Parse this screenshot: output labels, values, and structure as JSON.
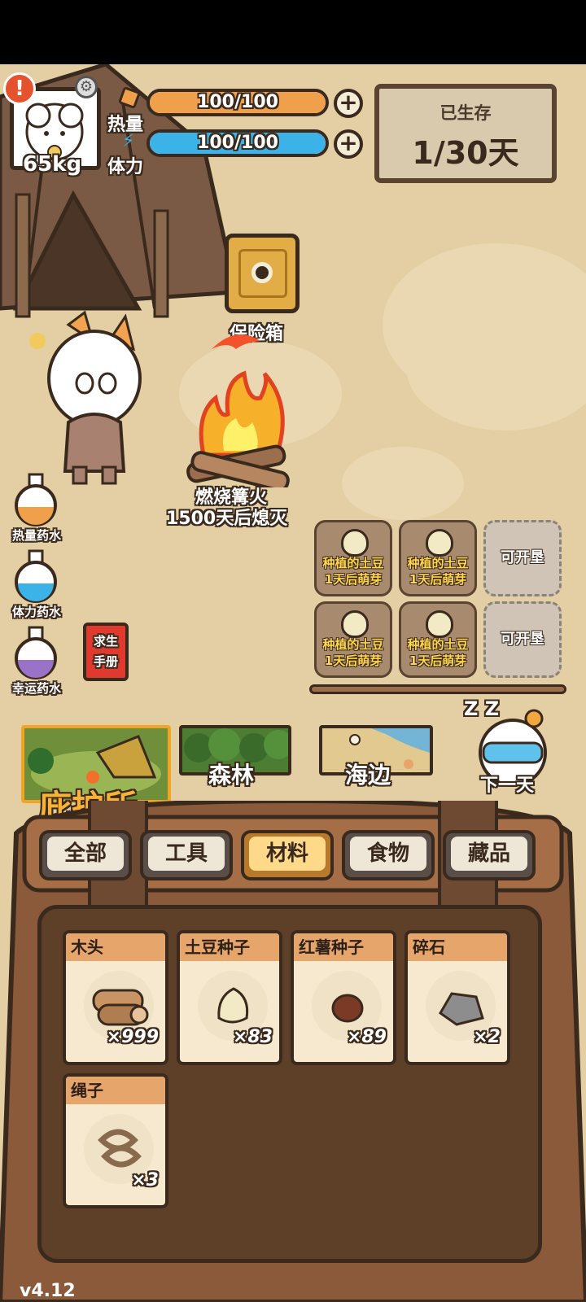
{
  "player": {
    "weight": "65kg"
  },
  "stats": {
    "calories": {
      "label": "热量",
      "value": "100/100",
      "fraction": 1.0,
      "color": "#f0a04b"
    },
    "stamina": {
      "label": "体力",
      "value": "100/100",
      "fraction": 1.0,
      "color": "#3bb2e8"
    }
  },
  "survival": {
    "title": "已生存",
    "days": "1/30天"
  },
  "safe": {
    "label": "保险箱"
  },
  "campfire": {
    "title": "燃烧篝火",
    "status": "1500天后熄灭"
  },
  "plots": [
    {
      "line1": "种植的土豆",
      "line2": "1天后萌芽",
      "empty": false
    },
    {
      "line1": "种植的土豆",
      "line2": "1天后萌芽",
      "empty": false
    },
    {
      "line1": "可开垦",
      "line2": "",
      "empty": true
    },
    {
      "line1": "种植的土豆",
      "line2": "1天后萌芽",
      "empty": false
    },
    {
      "line1": "种植的土豆",
      "line2": "1天后萌芽",
      "empty": false
    },
    {
      "line1": "可开垦",
      "line2": "",
      "empty": true
    }
  ],
  "potions": [
    {
      "label": "热量药水",
      "icon": "orange-potion-icon",
      "color": "#f0a04b"
    },
    {
      "label": "体力药水",
      "icon": "blue-potion-icon",
      "color": "#3bb2e8"
    },
    {
      "label": "幸运药水",
      "icon": "purple-potion-icon",
      "color": "#9a72c8"
    }
  ],
  "manual": {
    "line1": "求生",
    "line2": "手册"
  },
  "locations": {
    "shelter": "庇护所",
    "forest": "森林",
    "beach": "海边"
  },
  "next_day": {
    "label": "下一天",
    "sleep_mark": "Z Z"
  },
  "tabs": [
    "全部",
    "工具",
    "材料",
    "食物",
    "藏品"
  ],
  "active_tab": 2,
  "inventory": [
    {
      "name": "木头",
      "count": "×999",
      "icon": "log-icon"
    },
    {
      "name": "土豆种子",
      "count": "×83",
      "icon": "potato-seed-icon"
    },
    {
      "name": "红薯种子",
      "count": "×89",
      "icon": "sweet-potato-seed-icon"
    },
    {
      "name": "碎石",
      "count": "×2",
      "icon": "gravel-icon"
    },
    {
      "name": "绳子",
      "count": "×3",
      "icon": "rope-icon"
    }
  ],
  "version": "v4.12"
}
